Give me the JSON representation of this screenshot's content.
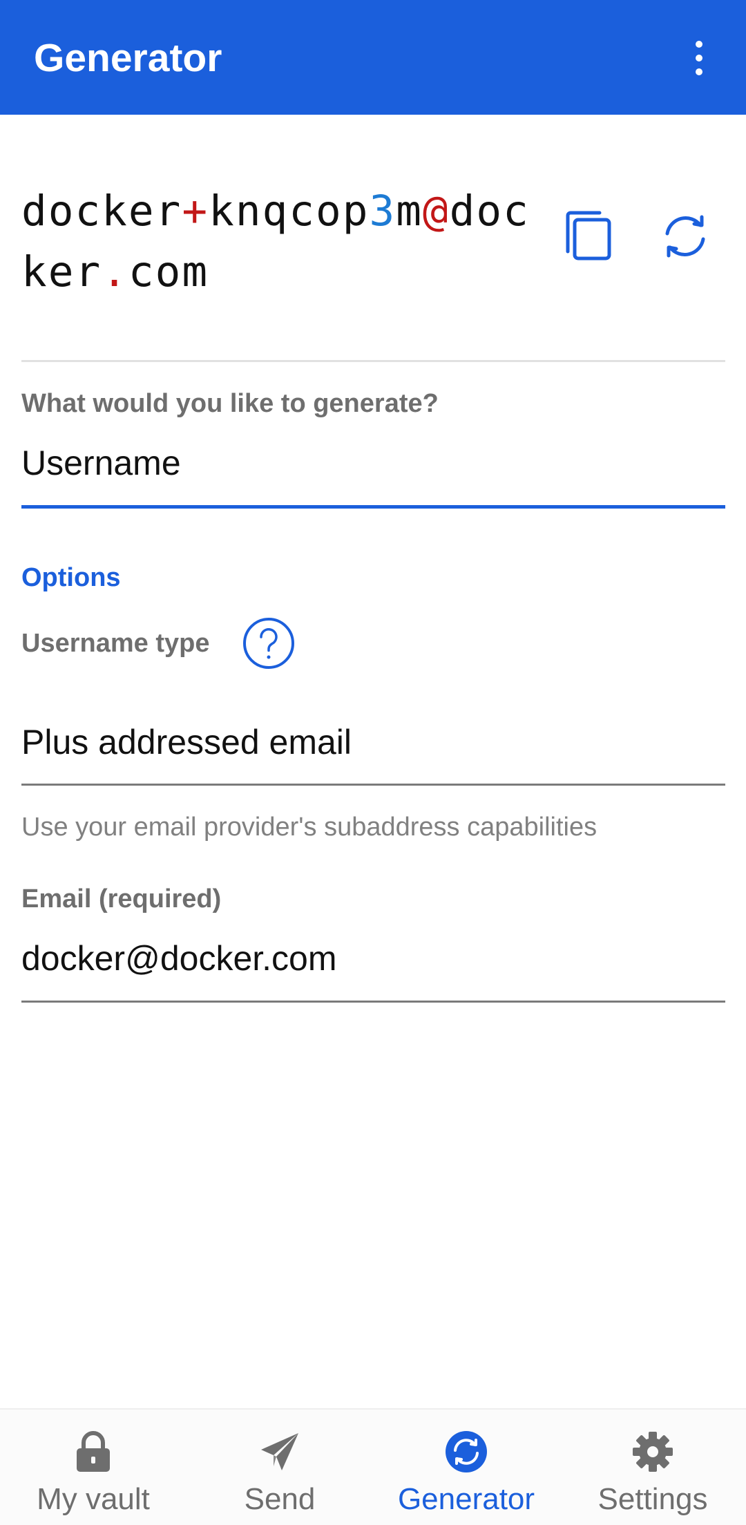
{
  "appbar": {
    "title": "Generator",
    "menu_icon": "overflow-menu-icon"
  },
  "generated": {
    "parts": [
      {
        "text": "docker",
        "kind": "text"
      },
      {
        "text": "+",
        "kind": "sym"
      },
      {
        "text": "knqcop",
        "kind": "text"
      },
      {
        "text": "3",
        "kind": "num"
      },
      {
        "text": "m",
        "kind": "text"
      },
      {
        "text": "@",
        "kind": "sym"
      },
      {
        "text": "docker",
        "kind": "text"
      },
      {
        "text": ".",
        "kind": "sym"
      },
      {
        "text": "com",
        "kind": "text"
      }
    ],
    "copy_icon": "copy-icon",
    "refresh_icon": "refresh-icon"
  },
  "generate_type": {
    "label": "What would you like to generate?",
    "value": "Username"
  },
  "options": {
    "title": "Options",
    "username_type_label": "Username type",
    "help_icon": "help-icon",
    "username_type_value": "Plus addressed email",
    "helper_text": "Use your email provider's subaddress capabilities",
    "email_label": "Email (required)",
    "email_value": "docker@docker.com"
  },
  "nav": {
    "items": [
      {
        "label": "My vault",
        "icon": "lock-icon",
        "active": false
      },
      {
        "label": "Send",
        "icon": "send-icon",
        "active": false
      },
      {
        "label": "Generator",
        "icon": "refresh-icon",
        "active": true
      },
      {
        "label": "Settings",
        "icon": "gear-icon",
        "active": false
      }
    ]
  },
  "colors": {
    "primary": "#1b5fdc",
    "symbol": "#c21717",
    "number": "#1d7bd4"
  }
}
